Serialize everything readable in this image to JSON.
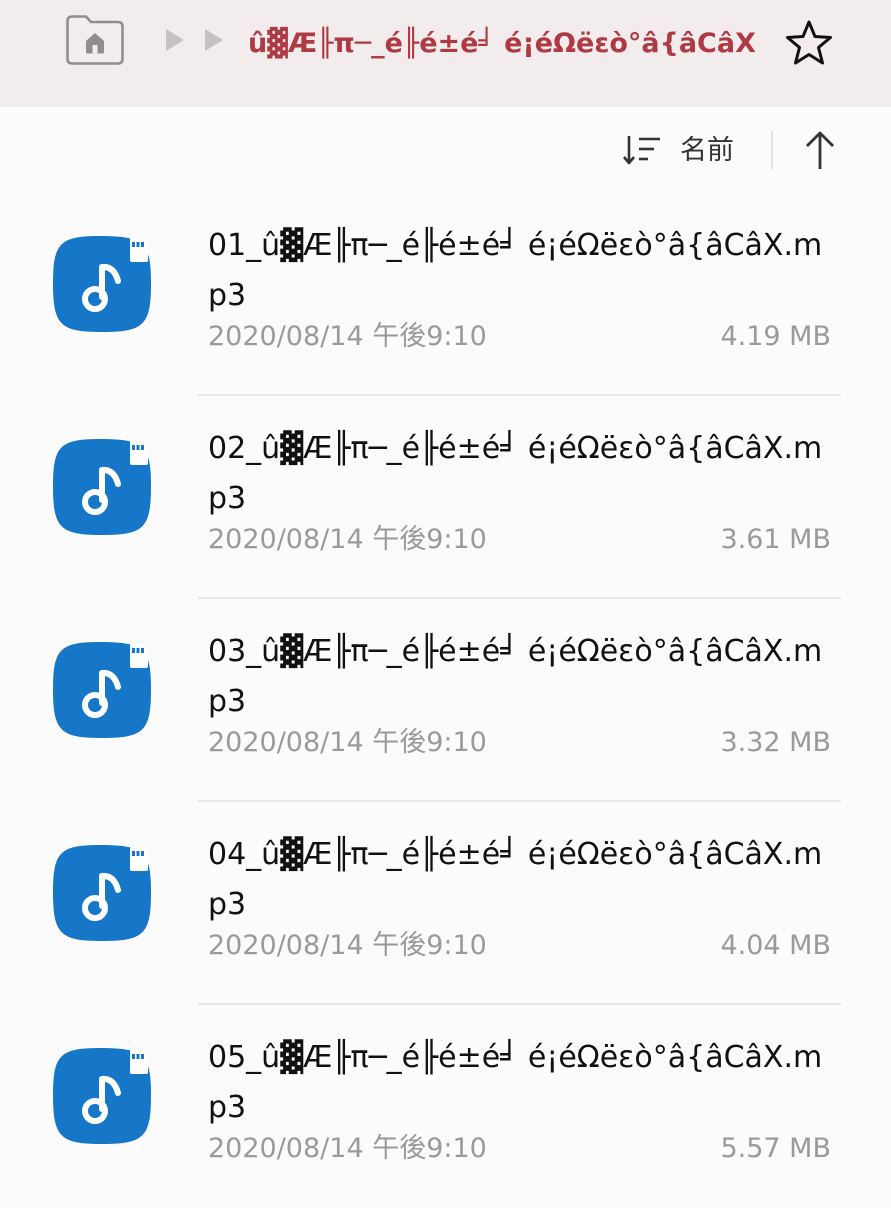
{
  "header": {
    "home_icon": "home-icon",
    "breadcrumb_title": "û▓Æ╟π─_é╟é±é╛ é¡éΩëεò°â{âCâX",
    "star_icon": "star-outline-icon",
    "accent_color": "#b03a44"
  },
  "sort": {
    "icon": "sort-icon",
    "label": "名前",
    "order_icon": "arrow-up-icon"
  },
  "files": [
    {
      "name": "01_û▓Æ╟π─_é╟é±é╛ é¡éΩëεò°â{âCâX.mp3",
      "date": "2020/08/14 午後9:10",
      "size": "4.19 MB",
      "icon": "music-sd-card-icon"
    },
    {
      "name": "02_û▓Æ╟π─_é╟é±é╛ é¡éΩëεò°â{âCâX.mp3",
      "date": "2020/08/14 午後9:10",
      "size": "3.61 MB",
      "icon": "music-sd-card-icon"
    },
    {
      "name": "03_û▓Æ╟π─_é╟é±é╛ é¡éΩëεò°â{âCâX.mp3",
      "date": "2020/08/14 午後9:10",
      "size": "3.32 MB",
      "icon": "music-sd-card-icon"
    },
    {
      "name": "04_û▓Æ╟π─_é╟é±é╛ é¡éΩëεò°â{âCâX.mp3",
      "date": "2020/08/14 午後9:10",
      "size": "4.04 MB",
      "icon": "music-sd-card-icon"
    },
    {
      "name": "05_û▓Æ╟π─_é╟é±é╛ é¡éΩëεò°â{âCâX.mp3",
      "date": "2020/08/14 午後9:10",
      "size": "5.57 MB",
      "icon": "music-sd-card-icon"
    }
  ]
}
